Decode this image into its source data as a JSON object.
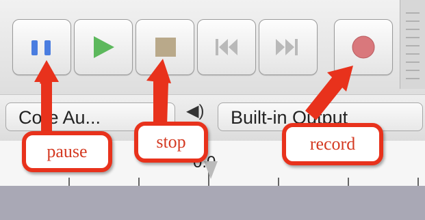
{
  "toolbar": {
    "buttons": [
      {
        "name": "pause-button",
        "icon": "pause-icon"
      },
      {
        "name": "play-button",
        "icon": "play-icon"
      },
      {
        "name": "stop-button",
        "icon": "stop-icon"
      },
      {
        "name": "skip-to-start-button",
        "icon": "skip-to-start-icon"
      },
      {
        "name": "skip-to-end-button",
        "icon": "skip-to-end-icon"
      },
      {
        "name": "record-button",
        "icon": "record-icon"
      }
    ],
    "colors": {
      "pause": "#4a7de0",
      "play": "#5cb85c",
      "stop": "#b9a98a",
      "skip": "#b9b9b9",
      "record": "#d9787c",
      "annotation": "#e8321c"
    }
  },
  "devices": {
    "input": "Core Au...",
    "output": "Built-in Output"
  },
  "ruler": {
    "label": "0.0"
  },
  "annotations": {
    "pause": "pause",
    "stop": "stop",
    "record": "record"
  }
}
